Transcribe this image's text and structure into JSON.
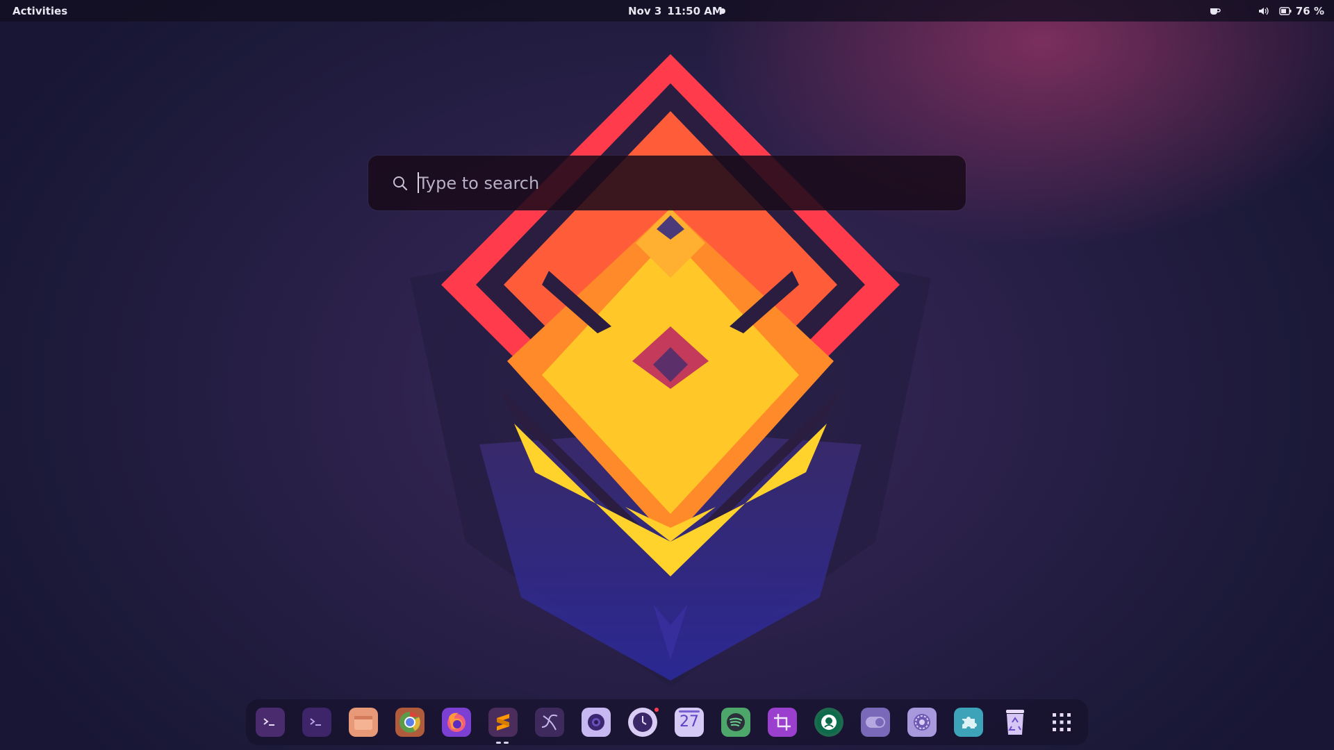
{
  "topbar": {
    "activities_label": "Activities",
    "date": "Nov 3",
    "time": "11:50 AM",
    "battery_percent": "76 %",
    "tray_icons": [
      "caffeine-icon",
      "volume-icon",
      "battery-icon"
    ]
  },
  "search": {
    "placeholder": "Type to search",
    "value": ""
  },
  "dock": {
    "items": [
      {
        "name": "terminal",
        "icon": "terminal-icon"
      },
      {
        "name": "terminal-alt",
        "icon": "terminal-icon"
      },
      {
        "name": "files",
        "icon": "folder-icon"
      },
      {
        "name": "chromium",
        "icon": "browser-icon"
      },
      {
        "name": "firefox",
        "icon": "firefox-icon"
      },
      {
        "name": "sublime-text",
        "icon": "sublime-icon"
      },
      {
        "name": "inkscape",
        "icon": "pen-curve-icon"
      },
      {
        "name": "screenshot",
        "icon": "camera-icon"
      },
      {
        "name": "clock",
        "icon": "clock-icon"
      },
      {
        "name": "calendar",
        "icon": "calendar-icon",
        "label": "27"
      },
      {
        "name": "spotify",
        "icon": "spotify-icon"
      },
      {
        "name": "crop-tool",
        "icon": "crop-icon"
      },
      {
        "name": "starbucks",
        "icon": "siren-logo-icon"
      },
      {
        "name": "toggle-settings",
        "icon": "toggle-icon"
      },
      {
        "name": "system-settings",
        "icon": "gear-icon"
      },
      {
        "name": "extensions",
        "icon": "puzzle-icon"
      },
      {
        "name": "trash",
        "icon": "recycle-icon"
      },
      {
        "name": "show-apps",
        "icon": "app-grid-icon"
      }
    ],
    "calendar_day": "27"
  },
  "colors": {
    "accent": "#7c5fc9",
    "topbar_text": "#e8e6f0",
    "search_bg": "#1a0a1a"
  }
}
